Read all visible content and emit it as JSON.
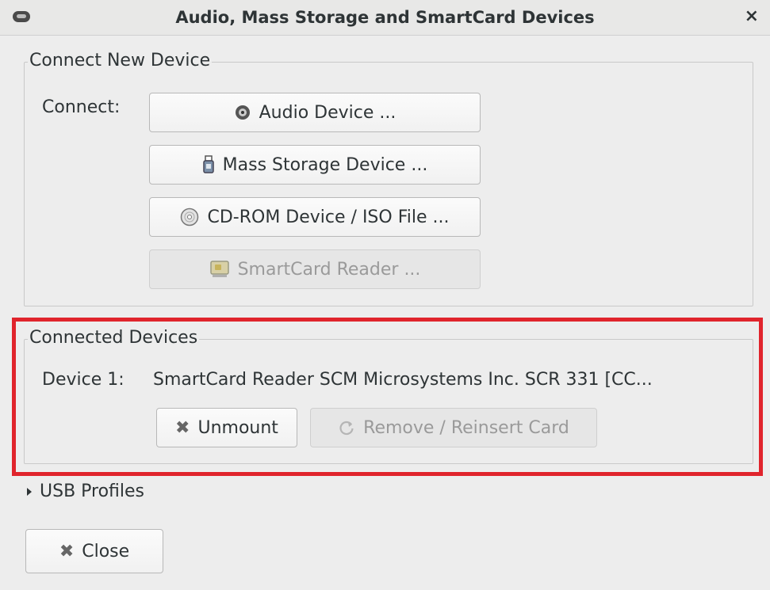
{
  "window": {
    "title": "Audio, Mass Storage and SmartCard Devices",
    "close_glyph": "×"
  },
  "connect_group": {
    "legend": "Connect New Device",
    "connect_label": "Connect:",
    "buttons": [
      {
        "label": "Audio Device ...",
        "icon": "speaker-icon",
        "enabled": true
      },
      {
        "label": "Mass Storage Device ...",
        "icon": "usb-drive-icon",
        "enabled": true
      },
      {
        "label": "CD-ROM Device / ISO File ...",
        "icon": "cd-icon",
        "enabled": true
      },
      {
        "label": "SmartCard Reader ...",
        "icon": "smartcard-icon",
        "enabled": false
      }
    ]
  },
  "connected_group": {
    "legend": "Connected Devices",
    "device_label": "Device 1:",
    "device_value": "SmartCard Reader SCM Microsystems Inc. SCR 331 [CC...",
    "unmount_label": "Unmount",
    "remove_label": "Remove / Reinsert Card",
    "highlight_color": "#e0242c"
  },
  "usb_profiles": {
    "label": "USB Profiles"
  },
  "footer": {
    "close_label": "Close"
  }
}
